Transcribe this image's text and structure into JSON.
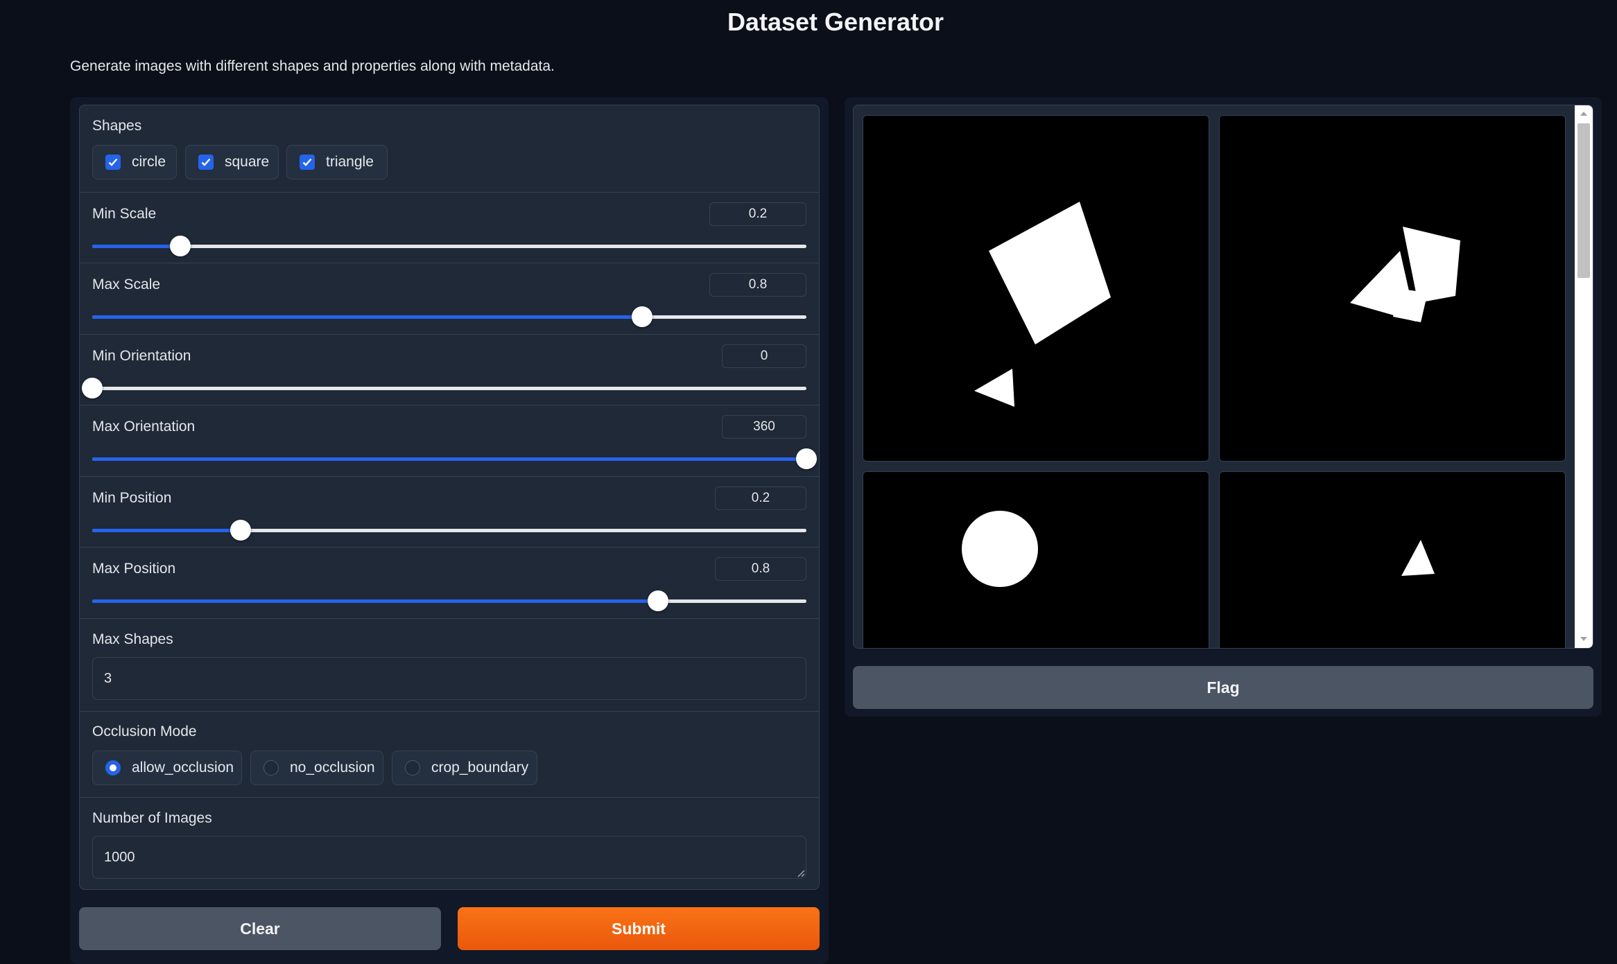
{
  "app": {
    "title": "Dataset Generator",
    "description": "Generate images with different shapes and properties along with metadata."
  },
  "form": {
    "shapes": {
      "label": "Shapes",
      "options": [
        {
          "label": "circle",
          "checked": true
        },
        {
          "label": "square",
          "checked": true
        },
        {
          "label": "triangle",
          "checked": true
        }
      ]
    },
    "sliders": [
      {
        "label": "Min Scale",
        "value": "0.2",
        "fraction": 0.123
      },
      {
        "label": "Max Scale",
        "value": "0.8",
        "fraction": 0.77
      },
      {
        "label": "Min Orientation",
        "value": "0",
        "fraction": 0.0
      },
      {
        "label": "Max Orientation",
        "value": "360",
        "fraction": 1.0
      },
      {
        "label": "Min Position",
        "value": "0.2",
        "fraction": 0.208
      },
      {
        "label": "Max Position",
        "value": "0.8",
        "fraction": 0.792
      }
    ],
    "max_shapes": {
      "label": "Max Shapes",
      "value": "3"
    },
    "occlusion_mode": {
      "label": "Occlusion Mode",
      "options": [
        {
          "label": "allow_occlusion",
          "selected": true
        },
        {
          "label": "no_occlusion",
          "selected": false
        },
        {
          "label": "crop_boundary",
          "selected": false
        }
      ]
    },
    "num_images": {
      "label": "Number of Images",
      "value": "1000"
    }
  },
  "buttons": {
    "clear": "Clear",
    "submit": "Submit",
    "flag": "Flag"
  },
  "gallery": {
    "images": [
      {
        "shapes": [
          "square",
          "triangle"
        ]
      },
      {
        "shapes": [
          "square",
          "triangle"
        ]
      },
      {
        "shapes": [
          "circle"
        ]
      },
      {
        "shapes": [
          "triangle"
        ]
      }
    ]
  },
  "colors": {
    "background": "#0b0f19",
    "panel": "#1f2937",
    "accent": "#2563eb",
    "submit": "#f97316",
    "secondary_button": "#4b5563"
  }
}
